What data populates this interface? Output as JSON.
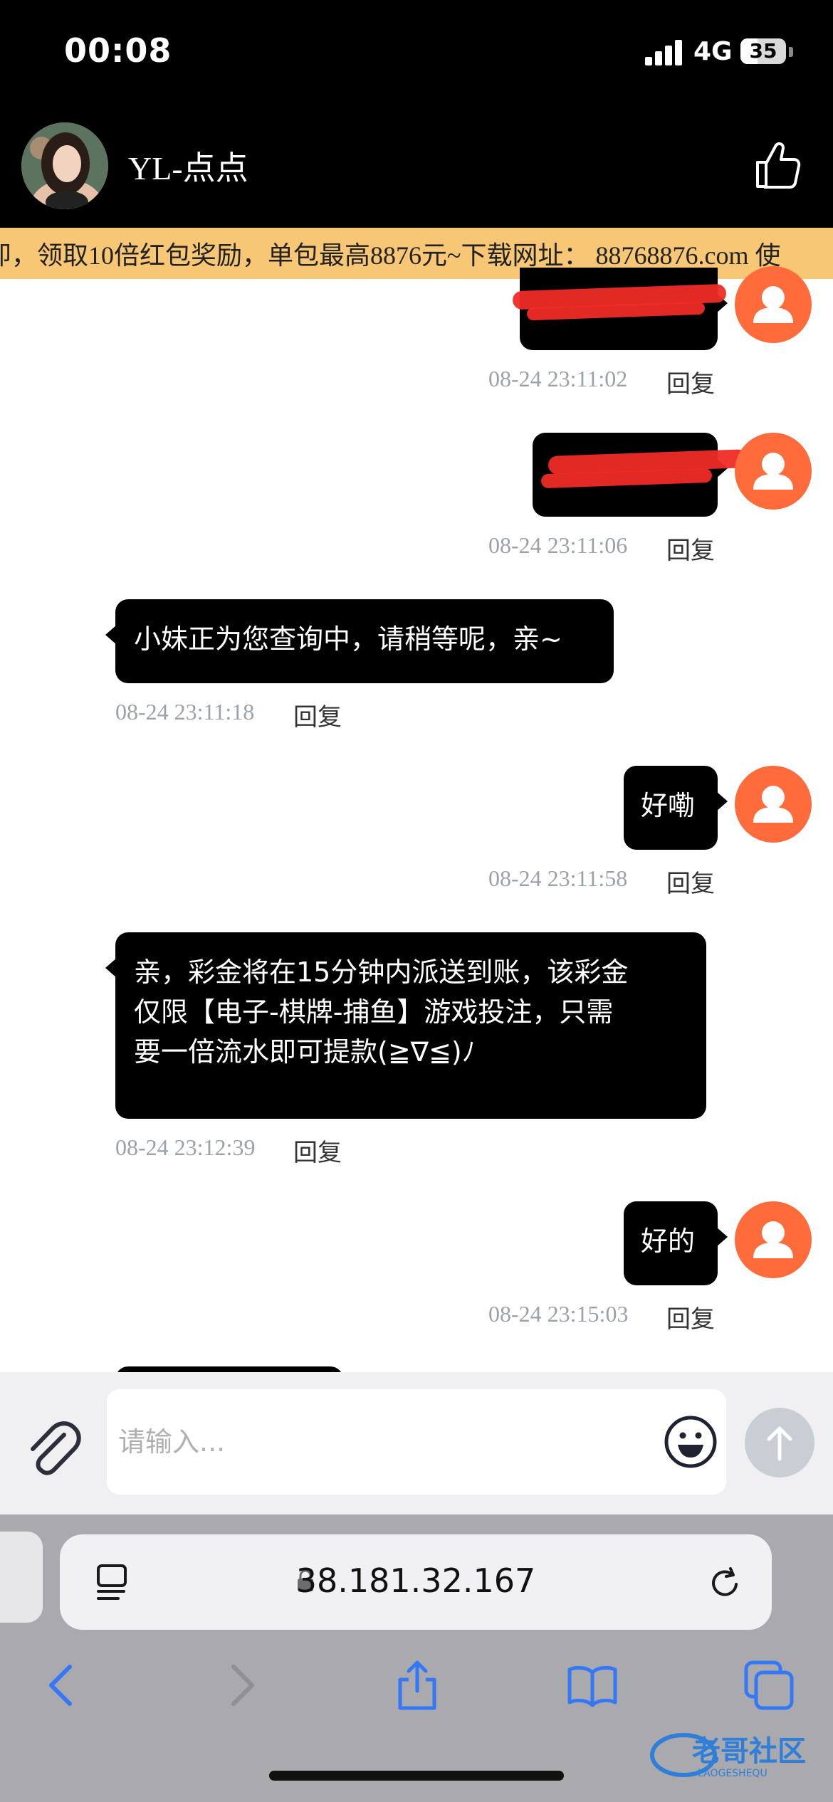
{
  "status_bar": {
    "time": "00:08",
    "network": "4G",
    "battery": "35"
  },
  "chat": {
    "title": "YL-点点"
  },
  "marquee": {
    "text": "即，领取10倍红包奖励，单包最高8876元~下载网址： 88768876.com 使"
  },
  "messages": [
    {
      "side": "right",
      "text": "",
      "time": "08-24 23:11:02",
      "reply": "回复"
    },
    {
      "side": "right",
      "text": "",
      "time": "08-24 23:11:06",
      "reply": "回复"
    },
    {
      "side": "left",
      "text": "小妹正为您查询中，请稍等呢，亲~",
      "time": "08-24 23:11:18",
      "reply": "回复"
    },
    {
      "side": "right",
      "text": "好嘞",
      "time": "08-24 23:11:58",
      "reply": "回复"
    },
    {
      "side": "left",
      "lines": [
        "亲，彩金将在15分钟内派送到账，该彩金",
        "仅限【电子-棋牌-捕鱼】游戏投注，只需",
        "要一倍流水即可提款(≧∇≦)ﾉ"
      ],
      "time": "08-24 23:12:39",
      "reply": "回复"
    },
    {
      "side": "right",
      "text": "好的",
      "time": "08-24 23:15:03",
      "reply": "回复"
    }
  ],
  "input": {
    "placeholder": "请输入..."
  },
  "browser": {
    "url": "38.181.32.167"
  },
  "watermark": {
    "text": "老哥社区",
    "subtext": "LAOGESHEQU"
  },
  "colors": {
    "accent": "#ff6b3b",
    "marquee_bg": "#f7c776",
    "bubble": "#000000",
    "ios_blue": "#3478f6"
  },
  "icons": [
    "attachment-icon",
    "emoji-icon",
    "send-arrow-icon",
    "thumbs-up-icon",
    "user-avatar-icon",
    "lock-icon",
    "reader-icon",
    "reload-icon",
    "back-icon",
    "forward-icon",
    "share-icon",
    "bookmarks-icon",
    "tabs-icon"
  ]
}
